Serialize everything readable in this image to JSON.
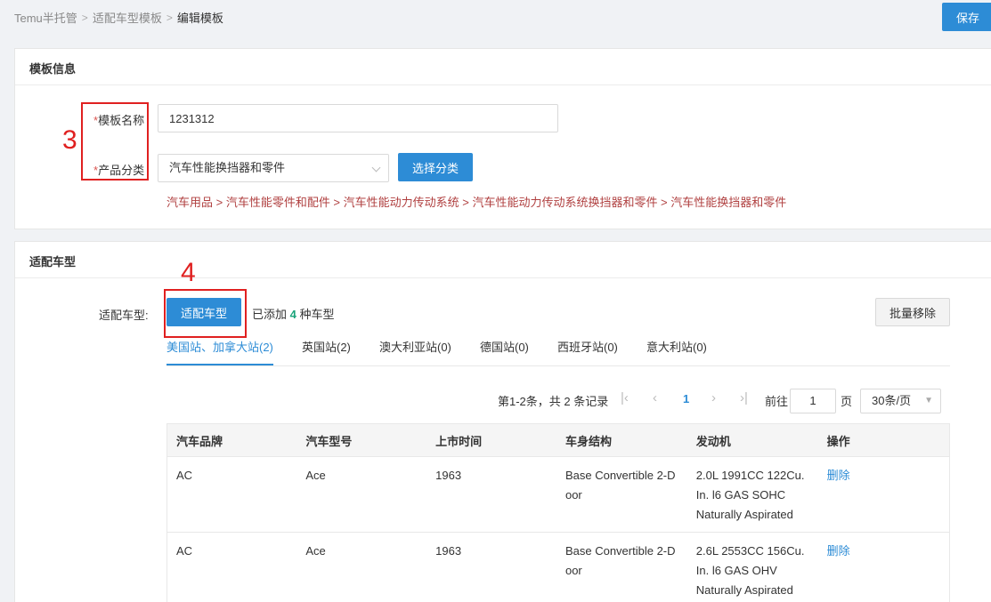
{
  "breadcrumb": {
    "items": [
      "Temu半托管",
      "适配车型模板"
    ],
    "separator": ">",
    "current": "编辑模板"
  },
  "toolbar": {
    "save_label": "保存"
  },
  "template_section": {
    "title": "模板信息",
    "name_label": "模板名称",
    "name_value": "1231312",
    "category_label": "产品分类",
    "category_value": "汽车性能换挡器和零件",
    "choose_button": "选择分类",
    "category_path": "汽车用品 > 汽车性能零件和配件 > 汽车性能动力传动系统 > 汽车性能动力传动系统换挡器和零件 > 汽车性能换挡器和零件",
    "required_mark": "*"
  },
  "fit_section": {
    "title": "适配车型",
    "field_label": "适配车型:",
    "fit_button": "适配车型",
    "added_prefix": "已添加",
    "added_count": "4",
    "added_suffix": "种车型",
    "batch_remove": "批量移除",
    "tabs": [
      {
        "label": "美国站、加拿大站(2)",
        "active": true
      },
      {
        "label": "英国站(2)",
        "active": false
      },
      {
        "label": "澳大利亚站(0)",
        "active": false
      },
      {
        "label": "德国站(0)",
        "active": false
      },
      {
        "label": "西班牙站(0)",
        "active": false
      },
      {
        "label": "意大利站(0)",
        "active": false
      }
    ]
  },
  "pagination": {
    "summary": "第1-2条，共 2 条记录",
    "current_page": "1",
    "goto_label": "前往",
    "goto_value": "1",
    "page_suffix": "页",
    "page_size": "30条/页"
  },
  "table": {
    "headers": [
      "汽车品牌",
      "汽车型号",
      "上市时间",
      "车身结构",
      "发动机",
      "操作"
    ],
    "rows": [
      {
        "brand": "AC",
        "model": "Ace",
        "year": "1963",
        "body": "Base Convertible 2-Door",
        "engine": "2.0L 1991CC 122Cu. In. l6 GAS SOHC Naturally Aspirated",
        "action": "删除"
      },
      {
        "brand": "AC",
        "model": "Ace",
        "year": "1963",
        "body": "Base Convertible 2-Door",
        "engine": "2.6L 2553CC 156Cu. In. l6 GAS OHV Naturally Aspirated",
        "action": "删除"
      }
    ]
  },
  "annotations": {
    "box3": "3",
    "box4": "4"
  },
  "colors": {
    "accent": "#2d8cd6",
    "annotation": "#e02020",
    "category_path": "#b04040"
  },
  "icons": [
    "chevron-down-icon",
    "first-page-icon",
    "prev-page-icon",
    "next-page-icon",
    "last-page-icon",
    "dropdown-caret-icon"
  ]
}
